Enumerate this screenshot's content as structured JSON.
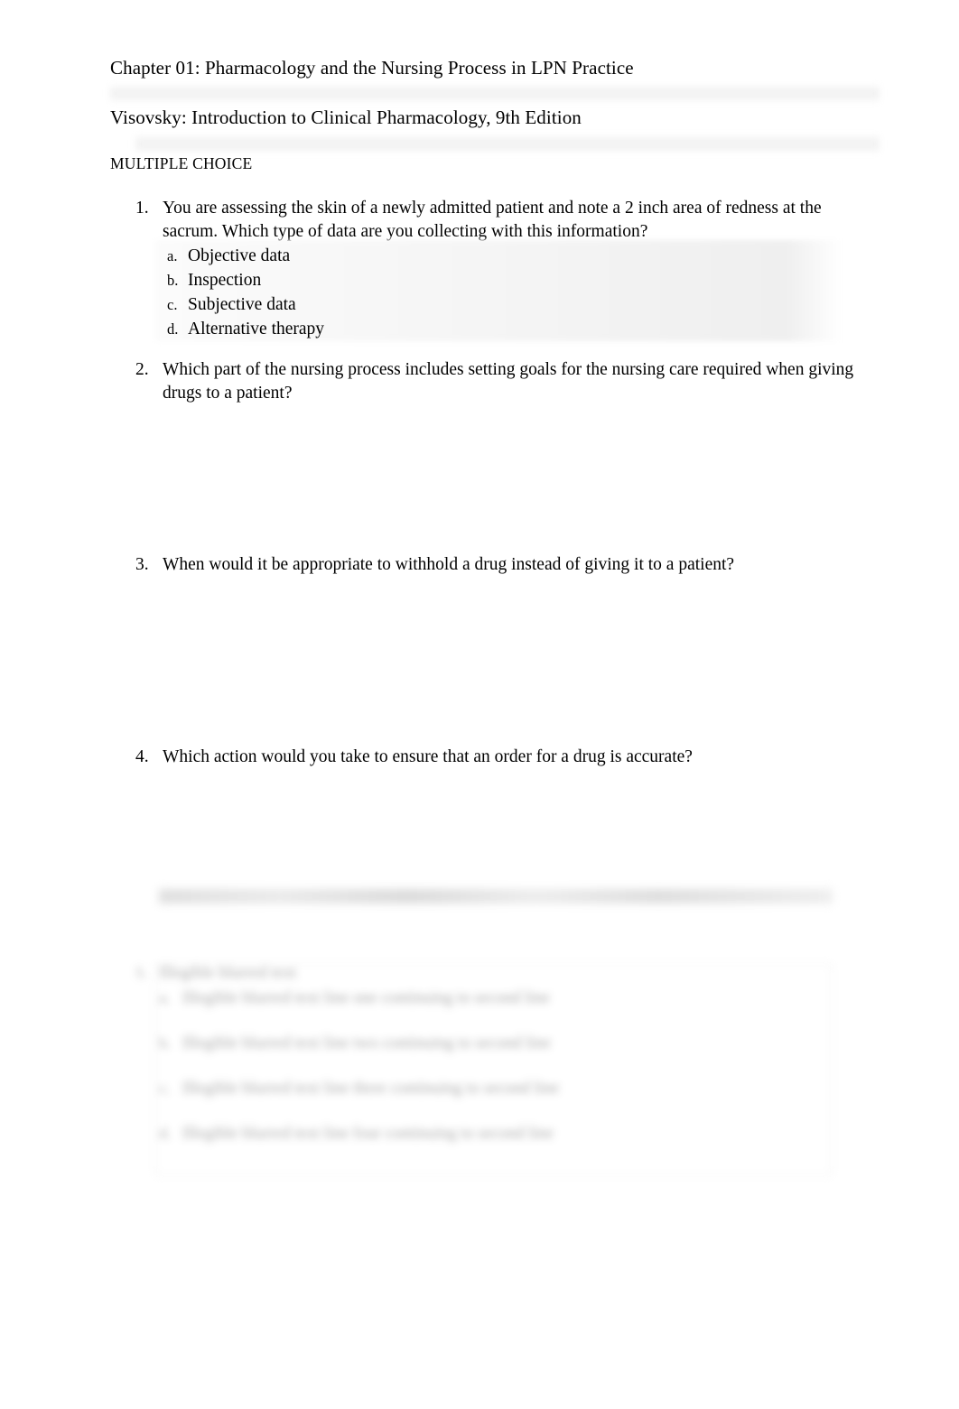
{
  "document": {
    "chapter_title": "Chapter 01: Pharmacology and the Nursing Process in LPN Practice",
    "edition_title": "Visovsky: Introduction to Clinical Pharmacology, 9th Edition",
    "section_label": "MULTIPLE CHOICE"
  },
  "questions": [
    {
      "number": "1.",
      "text": "You are assessing the skin of a newly admitted patient and note a 2 inch area of redness at the sacrum. Which type of data are you collecting with this information?",
      "options": [
        {
          "letter": "a.",
          "text": "Objective data"
        },
        {
          "letter": "b.",
          "text": "Inspection"
        },
        {
          "letter": "c.",
          "text": "Subjective data"
        },
        {
          "letter": "d.",
          "text": "Alternative therapy"
        }
      ]
    },
    {
      "number": "2.",
      "text": "Which part of the nursing process includes setting goals for the nursing care required when giving drugs to a patient?",
      "options": []
    },
    {
      "number": "3.",
      "text": "When would it be appropriate to withhold a drug instead of giving it to a patient?",
      "options": []
    },
    {
      "number": "4.",
      "text": "Which action would you take to ensure that an order for a drug is accurate?",
      "options": []
    }
  ],
  "blurred_question": {
    "number": "5.",
    "stem": "Illegible blurred text",
    "options": [
      {
        "letter": "a.",
        "text": "Illegible blurred text line one continuing to second line"
      },
      {
        "letter": "b.",
        "text": "Illegible blurred text line two continuing to second line"
      },
      {
        "letter": "c.",
        "text": "Illegible blurred text line three continuing to second line"
      },
      {
        "letter": "d.",
        "text": "Illegible blurred text line four continuing to second line"
      }
    ]
  }
}
